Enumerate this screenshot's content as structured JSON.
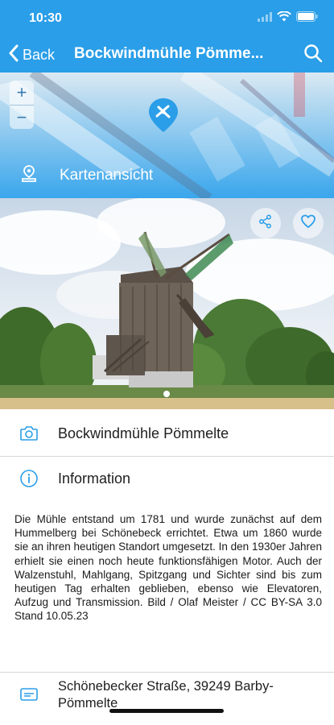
{
  "status_bar": {
    "time": "10:30"
  },
  "nav": {
    "back_label": "Back",
    "title": "Bockwindmühle Pömme..."
  },
  "map": {
    "zoom_in": "+",
    "zoom_out": "−",
    "label": "Kartenansicht"
  },
  "photo": {
    "pager": {
      "current": 1,
      "count": 1
    }
  },
  "info_rows": {
    "title": "Bockwindmühle Pömmelte",
    "information": "Information",
    "description": "Die Mühle entstand um 1781 und wurde zunächst auf dem Hummelberg bei Schönebeck errichtet. Etwa um 1860 wurde sie an ihren heutigen Standort umgesetzt. In den 1930er Jahren erhielt sie einen noch heute funktionsfähigen Motor. Auch der Walzenstuhl, Mahlgang, Spitzgang und Sichter sind bis zum heutigen Tag erhalten geblieben, ebenso wie Elevatoren, Aufzug und Transmission. Bild / Olaf Meister / CC BY-SA 3.0 Stand 10.05.23",
    "address": "Schönebecker Straße, 39249 Barby-Pömmelte"
  },
  "colors": {
    "header": "#2a9ee8",
    "icon_accent": "#2a9ee8",
    "divider": "#d8d8d8"
  },
  "icons": [
    "wifi-icon",
    "battery-icon",
    "back-chevron-icon",
    "search-icon",
    "map-pin-icon",
    "map-location-icon",
    "share-icon",
    "heart-icon",
    "camera-icon",
    "info-icon",
    "address-card-icon"
  ]
}
